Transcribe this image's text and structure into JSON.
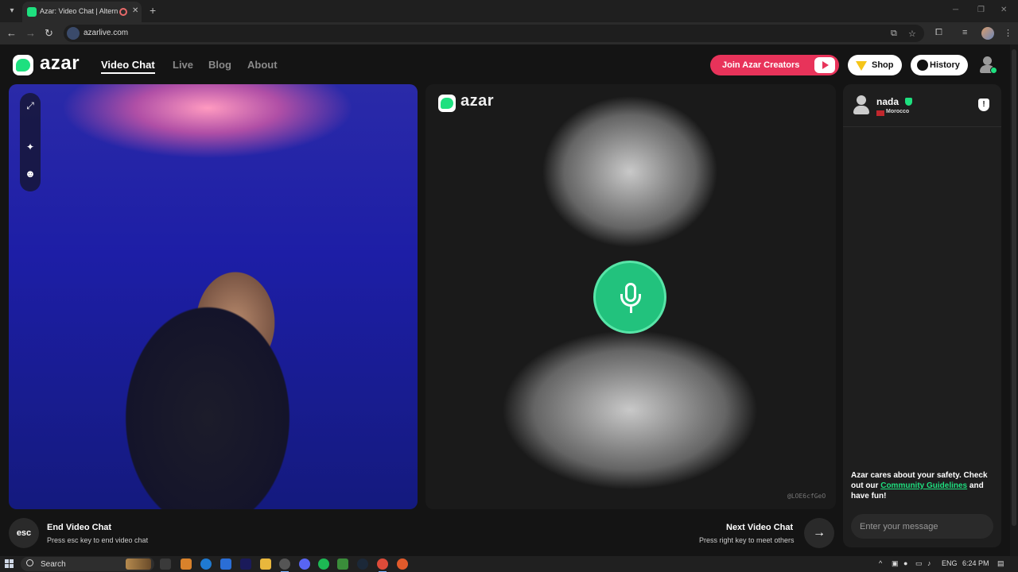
{
  "browser": {
    "tab_title": "Azar: Video Chat | Alternati",
    "url": "azarlive.com"
  },
  "header": {
    "logo_text": "azar",
    "nav": [
      "Video Chat",
      "Live",
      "Blog",
      "About"
    ],
    "active_nav": "Video Chat",
    "creators_label": "Join Azar Creators",
    "shop_label": "Shop",
    "history_label": "History"
  },
  "remote_video": {
    "logo_text": "azar",
    "stream_id": "@LOE6cfGeO"
  },
  "controls": {
    "esc_key": "esc",
    "end_title": "End Video Chat",
    "end_hint": "Press esc key to end video chat",
    "next_title": "Next Video Chat",
    "next_hint": "Press right key to meet others",
    "next_arrow": "→"
  },
  "chat": {
    "peer_name": "nada",
    "peer_country": "Morocco",
    "safety_text": "Azar cares about your safety. Check out our",
    "safety_link": "Community Guidelines",
    "safety_suffix": "and have fun!",
    "input_placeholder": "Enter your message"
  },
  "taskbar": {
    "search_label": "Search",
    "language": "ENG",
    "time": "6:24 PM"
  },
  "colors": {
    "brand_green": "#1ee07f",
    "creators_red": "#e8335a",
    "page_bg": "#141414"
  },
  "icons": [
    "expand-icon",
    "sparkle-icon",
    "face-icon",
    "mic-icon",
    "shield-report-icon",
    "arrow-right-icon",
    "user-avatar-icon",
    "gem-icon",
    "history-clock-icon"
  ]
}
